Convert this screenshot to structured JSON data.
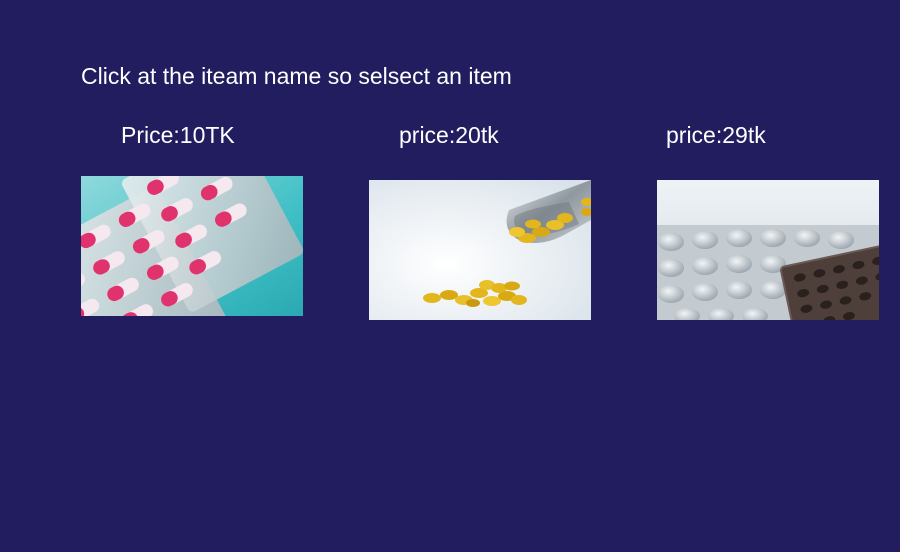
{
  "instruction": "Click at the iteam name so selsect an item",
  "items": [
    {
      "price_label": "Price:10TK",
      "image_name": "pink-capsule-blister-pack",
      "colors": {
        "background": "#46c3c8",
        "capsule_pink": "#e0336e",
        "capsule_white": "#f4e8ee"
      }
    },
    {
      "price_label": "price:20tk",
      "image_name": "yellow-pills-with-metal-scoop",
      "colors": {
        "background": "#eef3f7",
        "pill": "#e3b61d",
        "metal": "#9ea8b0"
      }
    },
    {
      "price_label": "price:29tk",
      "image_name": "silver-and-brown-blister-packs",
      "colors": {
        "background": "#dbe4ea",
        "silver": "#b9c0c6",
        "brown": "#4e3f3a"
      }
    }
  ],
  "colors": {
    "page_background": "#211d5e",
    "text": "#ffffff"
  }
}
